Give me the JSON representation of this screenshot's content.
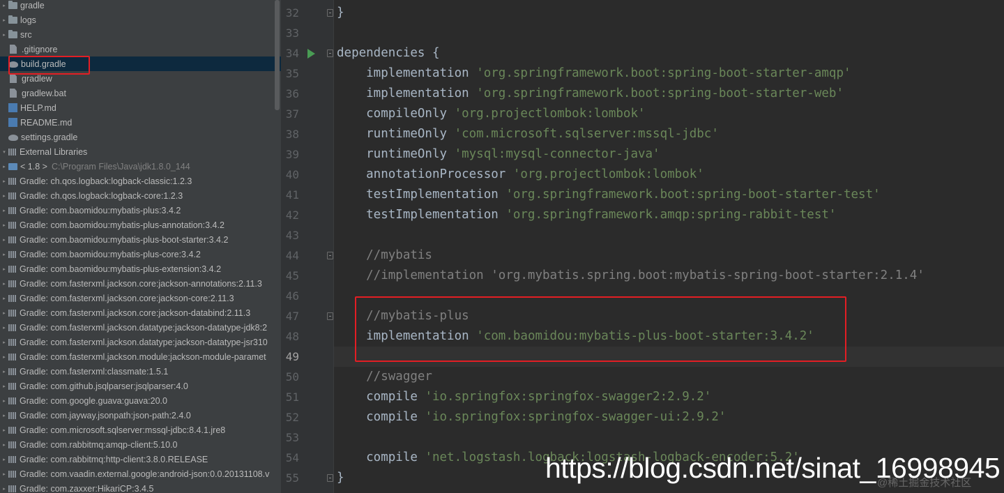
{
  "project_tree": {
    "items": [
      {
        "label": "gradle",
        "icon": "folder-icon",
        "arrow": "▸",
        "hint": ""
      },
      {
        "label": "logs",
        "icon": "folder-icon",
        "arrow": "▸",
        "hint": ""
      },
      {
        "label": "src",
        "icon": "folder-icon",
        "arrow": "▸",
        "hint": ""
      },
      {
        "label": ".gitignore",
        "icon": "gitignore-file-icon",
        "arrow": "",
        "hint": ""
      },
      {
        "label": "build.gradle",
        "icon": "gradle-file-icon",
        "arrow": "",
        "hint": "",
        "selected": true
      },
      {
        "label": "gradlew",
        "icon": "file-icon",
        "arrow": "",
        "hint": ""
      },
      {
        "label": "gradlew.bat",
        "icon": "file-icon",
        "arrow": "",
        "hint": ""
      },
      {
        "label": "HELP.md",
        "icon": "markdown-file-icon",
        "arrow": "",
        "hint": ""
      },
      {
        "label": "README.md",
        "icon": "markdown-file-icon",
        "arrow": "",
        "hint": ""
      },
      {
        "label": "settings.gradle",
        "icon": "gradle-file-icon",
        "arrow": "",
        "hint": ""
      },
      {
        "label": "External Libraries",
        "icon": "library-root-icon",
        "arrow": "▾",
        "hint": "",
        "root": true
      },
      {
        "label": "< 1.8 >",
        "icon": "jdk-icon",
        "arrow": "▸",
        "hint": "C:\\Program Files\\Java\\jdk1.8.0_144"
      },
      {
        "label": "Gradle: ch.qos.logback:logback-classic:1.2.3",
        "icon": "library-icon",
        "arrow": "▸",
        "hint": ""
      },
      {
        "label": "Gradle: ch.qos.logback:logback-core:1.2.3",
        "icon": "library-icon",
        "arrow": "▸",
        "hint": ""
      },
      {
        "label": "Gradle: com.baomidou:mybatis-plus:3.4.2",
        "icon": "library-icon",
        "arrow": "▸",
        "hint": ""
      },
      {
        "label": "Gradle: com.baomidou:mybatis-plus-annotation:3.4.2",
        "icon": "library-icon",
        "arrow": "▸",
        "hint": ""
      },
      {
        "label": "Gradle: com.baomidou:mybatis-plus-boot-starter:3.4.2",
        "icon": "library-icon",
        "arrow": "▸",
        "hint": ""
      },
      {
        "label": "Gradle: com.baomidou:mybatis-plus-core:3.4.2",
        "icon": "library-icon",
        "arrow": "▸",
        "hint": ""
      },
      {
        "label": "Gradle: com.baomidou:mybatis-plus-extension:3.4.2",
        "icon": "library-icon",
        "arrow": "▸",
        "hint": ""
      },
      {
        "label": "Gradle: com.fasterxml.jackson.core:jackson-annotations:2.11.3",
        "icon": "library-icon",
        "arrow": "▸",
        "hint": ""
      },
      {
        "label": "Gradle: com.fasterxml.jackson.core:jackson-core:2.11.3",
        "icon": "library-icon",
        "arrow": "▸",
        "hint": ""
      },
      {
        "label": "Gradle: com.fasterxml.jackson.core:jackson-databind:2.11.3",
        "icon": "library-icon",
        "arrow": "▸",
        "hint": ""
      },
      {
        "label": "Gradle: com.fasterxml.jackson.datatype:jackson-datatype-jdk8:2",
        "icon": "library-icon",
        "arrow": "▸",
        "hint": ""
      },
      {
        "label": "Gradle: com.fasterxml.jackson.datatype:jackson-datatype-jsr310",
        "icon": "library-icon",
        "arrow": "▸",
        "hint": ""
      },
      {
        "label": "Gradle: com.fasterxml.jackson.module:jackson-module-paramet",
        "icon": "library-icon",
        "arrow": "▸",
        "hint": ""
      },
      {
        "label": "Gradle: com.fasterxml:classmate:1.5.1",
        "icon": "library-icon",
        "arrow": "▸",
        "hint": ""
      },
      {
        "label": "Gradle: com.github.jsqlparser:jsqlparser:4.0",
        "icon": "library-icon",
        "arrow": "▸",
        "hint": ""
      },
      {
        "label": "Gradle: com.google.guava:guava:20.0",
        "icon": "library-icon",
        "arrow": "▸",
        "hint": ""
      },
      {
        "label": "Gradle: com.jayway.jsonpath:json-path:2.4.0",
        "icon": "library-icon",
        "arrow": "▸",
        "hint": ""
      },
      {
        "label": "Gradle: com.microsoft.sqlserver:mssql-jdbc:8.4.1.jre8",
        "icon": "library-icon",
        "arrow": "▸",
        "hint": ""
      },
      {
        "label": "Gradle: com.rabbitmq:amqp-client:5.10.0",
        "icon": "library-icon",
        "arrow": "▸",
        "hint": ""
      },
      {
        "label": "Gradle: com.rabbitmq:http-client:3.8.0.RELEASE",
        "icon": "library-icon",
        "arrow": "▸",
        "hint": ""
      },
      {
        "label": "Gradle: com.vaadin.external.google:android-json:0.0.20131108.v",
        "icon": "library-icon",
        "arrow": "▸",
        "hint": ""
      },
      {
        "label": "Gradle: com.zaxxer:HikariCP:3.4.5",
        "icon": "library-icon",
        "arrow": "▸",
        "hint": ""
      }
    ]
  },
  "editor": {
    "current_line": "49",
    "lines": [
      {
        "num": "32",
        "parts": [
          {
            "t": "}",
            "c": "kw"
          }
        ],
        "fold": true
      },
      {
        "num": "33",
        "parts": []
      },
      {
        "num": "34",
        "parts": [
          {
            "t": "dependencies {",
            "c": "kw"
          }
        ],
        "fold": true,
        "run": true
      },
      {
        "num": "35",
        "parts": [
          {
            "t": "    implementation ",
            "c": "kw"
          },
          {
            "t": "'org.springframework.boot:spring-boot-starter-amqp'",
            "c": "str"
          }
        ]
      },
      {
        "num": "36",
        "parts": [
          {
            "t": "    implementation ",
            "c": "kw"
          },
          {
            "t": "'org.springframework.boot:spring-boot-starter-web'",
            "c": "str"
          }
        ]
      },
      {
        "num": "37",
        "parts": [
          {
            "t": "    compileOnly ",
            "c": "kw"
          },
          {
            "t": "'org.projectlombok:lombok'",
            "c": "str"
          }
        ]
      },
      {
        "num": "38",
        "parts": [
          {
            "t": "    runtimeOnly ",
            "c": "kw"
          },
          {
            "t": "'com.microsoft.sqlserver:mssql-jdbc'",
            "c": "str"
          }
        ]
      },
      {
        "num": "39",
        "parts": [
          {
            "t": "    runtimeOnly ",
            "c": "kw"
          },
          {
            "t": "'mysql:mysql-connector-java'",
            "c": "str"
          }
        ]
      },
      {
        "num": "40",
        "parts": [
          {
            "t": "    annotationProcessor ",
            "c": "kw"
          },
          {
            "t": "'org.projectlombok:lombok'",
            "c": "str"
          }
        ]
      },
      {
        "num": "41",
        "parts": [
          {
            "t": "    testImplementation ",
            "c": "kw"
          },
          {
            "t": "'org.springframework.boot:spring-boot-starter-test'",
            "c": "str"
          }
        ]
      },
      {
        "num": "42",
        "parts": [
          {
            "t": "    testImplementation ",
            "c": "kw"
          },
          {
            "t": "'org.springframework.amqp:spring-rabbit-test'",
            "c": "str"
          }
        ]
      },
      {
        "num": "43",
        "parts": []
      },
      {
        "num": "44",
        "parts": [
          {
            "t": "    //mybatis",
            "c": "cmt"
          }
        ],
        "fold": true
      },
      {
        "num": "45",
        "parts": [
          {
            "t": "    //implementation 'org.mybatis.spring.boot:mybatis-spring-boot-starter:2.1.4'",
            "c": "cmt"
          }
        ]
      },
      {
        "num": "46",
        "parts": []
      },
      {
        "num": "47",
        "parts": [
          {
            "t": "    //mybatis-plus",
            "c": "cmt"
          }
        ],
        "fold": true
      },
      {
        "num": "48",
        "parts": [
          {
            "t": "    implementation ",
            "c": "kw"
          },
          {
            "t": "'com.baomidou:mybatis-plus-boot-starter:3.4.2'",
            "c": "str"
          }
        ]
      },
      {
        "num": "49",
        "parts": []
      },
      {
        "num": "50",
        "parts": [
          {
            "t": "    //swagger",
            "c": "cmt"
          }
        ]
      },
      {
        "num": "51",
        "parts": [
          {
            "t": "    compile ",
            "c": "kw"
          },
          {
            "t": "'io.springfox:springfox-swagger2:2.9.2'",
            "c": "str"
          }
        ]
      },
      {
        "num": "52",
        "parts": [
          {
            "t": "    compile ",
            "c": "kw"
          },
          {
            "t": "'io.springfox:springfox-swagger-ui:2.9.2'",
            "c": "str"
          }
        ]
      },
      {
        "num": "53",
        "parts": []
      },
      {
        "num": "54",
        "parts": [
          {
            "t": "    compile ",
            "c": "kw"
          },
          {
            "t": "'net.logstash.logback:logstash-logback-encoder:5.2'",
            "c": "str"
          }
        ]
      },
      {
        "num": "55",
        "parts": [
          {
            "t": "}",
            "c": "kw"
          }
        ],
        "fold": true
      }
    ]
  },
  "watermark": {
    "url": "https://blog.csdn.net/sinat_16998945",
    "secondary": "@稀土掘金技术社区"
  },
  "colors": {
    "highlight_box": "#e31e24",
    "string": "#6a8759",
    "comment": "#808080",
    "code_text": "#a9b7c6",
    "run_icon": "#499c54"
  }
}
